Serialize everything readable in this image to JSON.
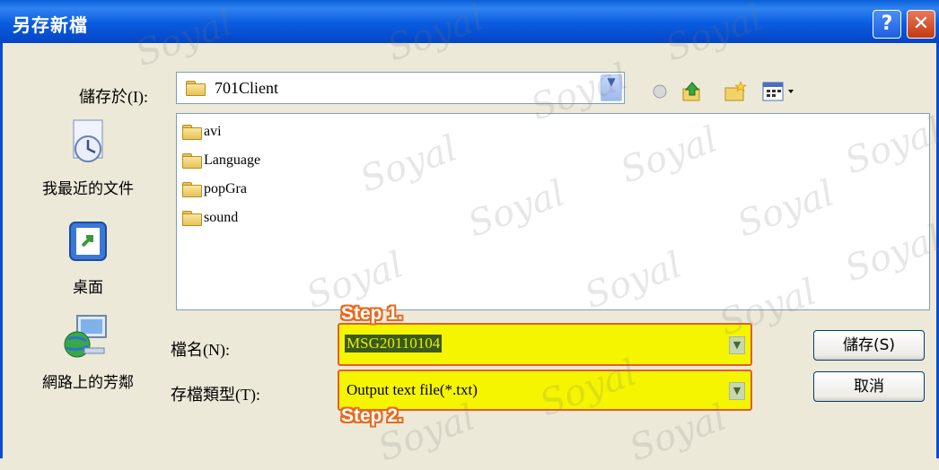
{
  "window": {
    "title": "另存新檔",
    "help_glyph": "?",
    "close_glyph": "✕"
  },
  "save_in": {
    "label": "儲存於(I):",
    "value": "701Client"
  },
  "places": [
    {
      "label": "我最近的文件",
      "icon": "recent-documents-icon"
    },
    {
      "label": "桌面",
      "icon": "desktop-icon"
    },
    {
      "label": "網路上的芳鄰",
      "icon": "network-places-icon"
    }
  ],
  "files": [
    {
      "name": "avi"
    },
    {
      "name": "Language"
    },
    {
      "name": "popGra"
    },
    {
      "name": "sound"
    }
  ],
  "filename": {
    "label": "檔名(N):",
    "value": "MSG20110104"
  },
  "filetype": {
    "label": "存檔類型(T):",
    "value": "Output text file(*.txt)"
  },
  "buttons": {
    "save": "儲存(S)",
    "cancel": "取消"
  },
  "annotations": {
    "step1": "Step 1.",
    "step2": "Step 2."
  },
  "watermark_text": "Soyal",
  "colors": {
    "highlight": "#f5f500",
    "step_outline": "#e86a1e",
    "titlebar": "#0a5be0"
  }
}
